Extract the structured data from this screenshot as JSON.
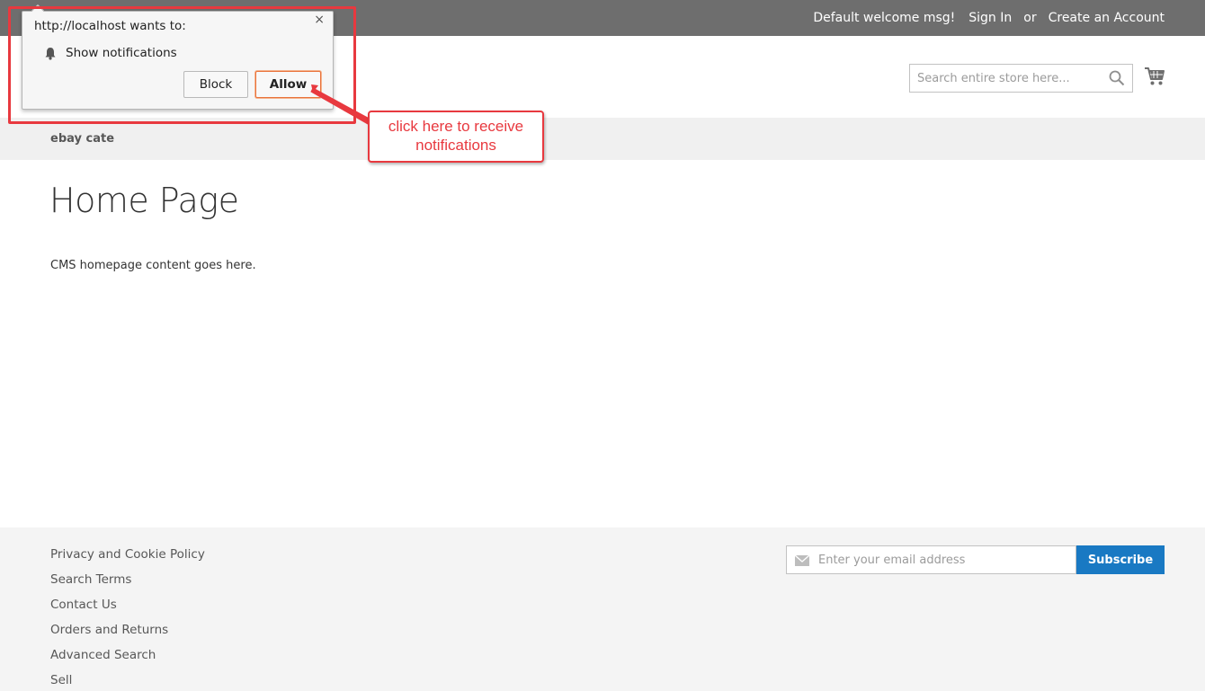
{
  "top_links": {
    "welcome": "Default welcome msg!",
    "sign_in": "Sign In",
    "or": "or",
    "create_account": "Create an Account"
  },
  "search": {
    "placeholder": "Search entire store here..."
  },
  "nav": {
    "item": "ebay cate"
  },
  "main": {
    "title": "Home Page",
    "content": "CMS homepage content goes here."
  },
  "footer": {
    "links": [
      "Privacy and Cookie Policy",
      "Search Terms",
      "Contact Us",
      "Orders and Returns",
      "Advanced Search",
      "Sell"
    ],
    "newsletter_placeholder": "Enter your email address",
    "subscribe": "Subscribe"
  },
  "notification": {
    "title": "http://localhost wants to:",
    "permission": "Show notifications",
    "block": "Block",
    "allow": "Allow",
    "close": "×"
  },
  "callout": {
    "line1": "click here to receive",
    "line2": "notifications"
  },
  "colors": {
    "top_bar": "#6e6e6e",
    "subscribe": "#1979c3",
    "annotation": "#e8393f"
  }
}
